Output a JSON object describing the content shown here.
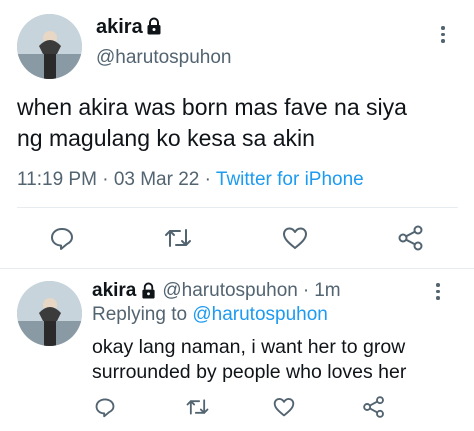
{
  "main_tweet": {
    "author_name": "akira",
    "handle": "@harutospuhon",
    "text_line1": "when akira was born mas fave na siya",
    "text_line2": "ng magulang ko kesa sa akin",
    "time": "11:19 PM",
    "sep1": "·",
    "date": "03 Mar 22",
    "sep2": "·",
    "source": "Twitter for iPhone",
    "actions": [
      "reply-icon",
      "retweet-icon",
      "like-icon",
      "share-icon"
    ]
  },
  "reply_tweet": {
    "author_name": "akira",
    "handle": "@harutospuhon",
    "sep": "·",
    "time_ago": "1m",
    "replying_prefix": "Replying to",
    "replying_to": "@harutospuhon",
    "text_line1": "okay lang naman, i want her to grow",
    "text_line2": "surrounded by people who loves her",
    "actions": [
      "reply-icon",
      "retweet-icon",
      "like-icon",
      "share-icon"
    ]
  },
  "colors": {
    "accent": "#1d9bf0",
    "muted": "#536471",
    "divider": "#e6ecf0"
  }
}
